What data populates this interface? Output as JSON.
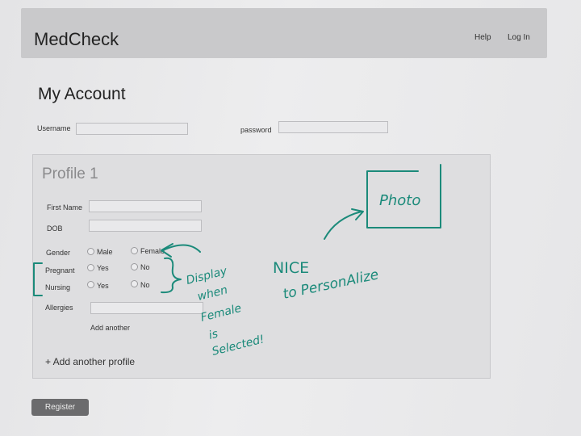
{
  "app": {
    "title": "MedCheck"
  },
  "nav": {
    "help": "Help",
    "login": "Log In"
  },
  "page": {
    "title": "My Account"
  },
  "account": {
    "username_label": "Username",
    "password_label": "password"
  },
  "profile": {
    "title": "Profile 1",
    "first_name_label": "First Name",
    "dob_label": "DOB",
    "gender_label": "Gender",
    "gender_options": [
      "Male",
      "Female"
    ],
    "pregnant_label": "Pregnant",
    "pregnant_options": [
      "Yes",
      "No"
    ],
    "nursing_label": "Nursing",
    "nursing_options": [
      "Yes",
      "No"
    ],
    "allergies_label": "Allergies",
    "add_another": "Add another",
    "add_profile": "+ Add another profile"
  },
  "register_label": "Register",
  "annotations": {
    "photo": "Photo",
    "nice": "NICE",
    "personalize": "to PersonAlize",
    "display_lines": [
      "Display",
      "when",
      "Female",
      "is",
      "Selected!"
    ],
    "ink_color": "#1b8a7a"
  }
}
